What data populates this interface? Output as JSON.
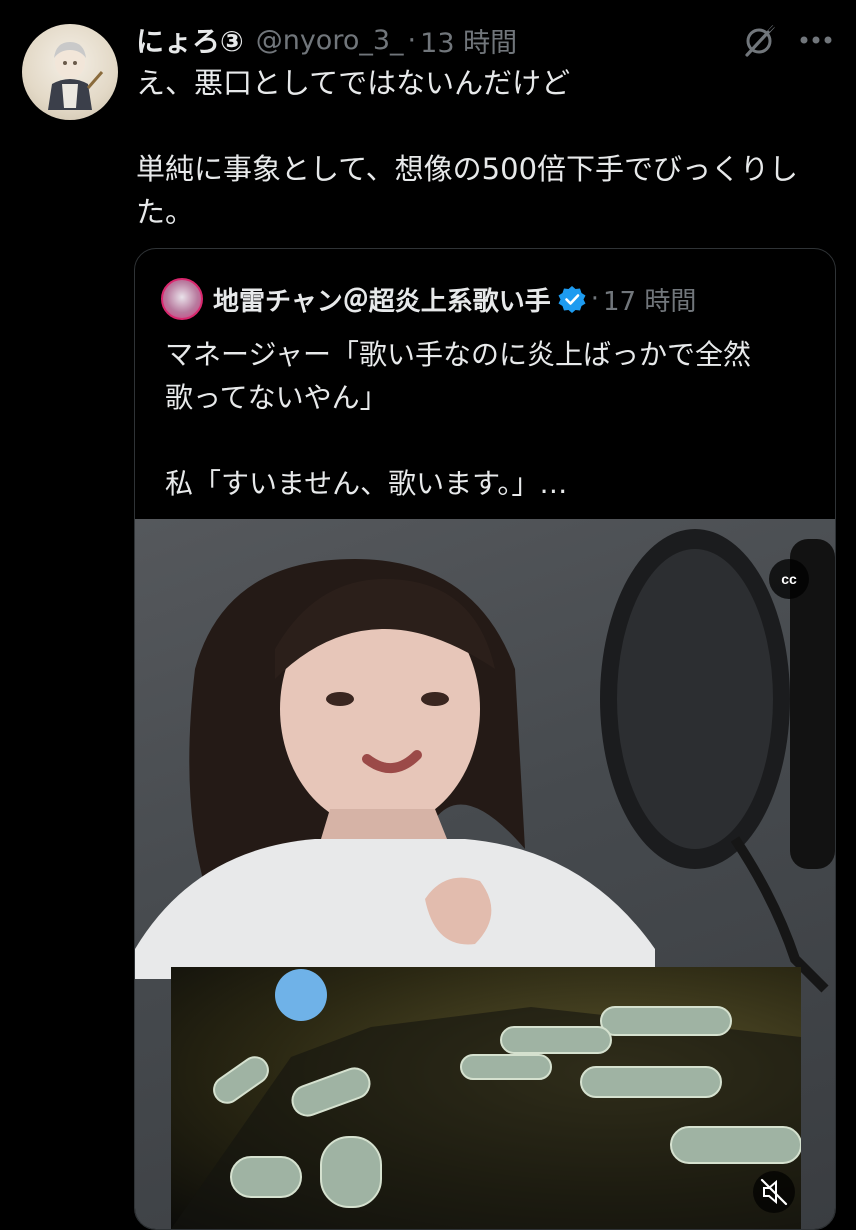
{
  "tweet": {
    "display_name": "にょろ③",
    "handle": "@nyoro_3_",
    "separator": "·",
    "time": "13 時間",
    "text_lines": [
      "え、悪口としてではないんだけど",
      "",
      "単純に事象として、想像の500倍下手でびっくりし",
      "た。"
    ]
  },
  "quoted": {
    "display_name": "地雷チャン＠超炎上系歌い手",
    "separator": "·",
    "time": "17 時間",
    "text_lines": [
      "マネージャー「歌い手なのに炎上ばっかで全然",
      "歌ってないやん」",
      "",
      "私「すいません、歌います。」…"
    ]
  },
  "media": {
    "cc_label": "cc"
  },
  "icons": {
    "grok": "grok-icon",
    "more": "more-icon",
    "verified": "verified-badge-icon",
    "mute": "muted-speaker-icon",
    "cc": "closed-captions-icon"
  },
  "colors": {
    "background": "#000000",
    "primary_text": "#e7e9ea",
    "secondary_text": "#71767b",
    "verified": "#1d9bf0",
    "border": "#2f3336"
  }
}
